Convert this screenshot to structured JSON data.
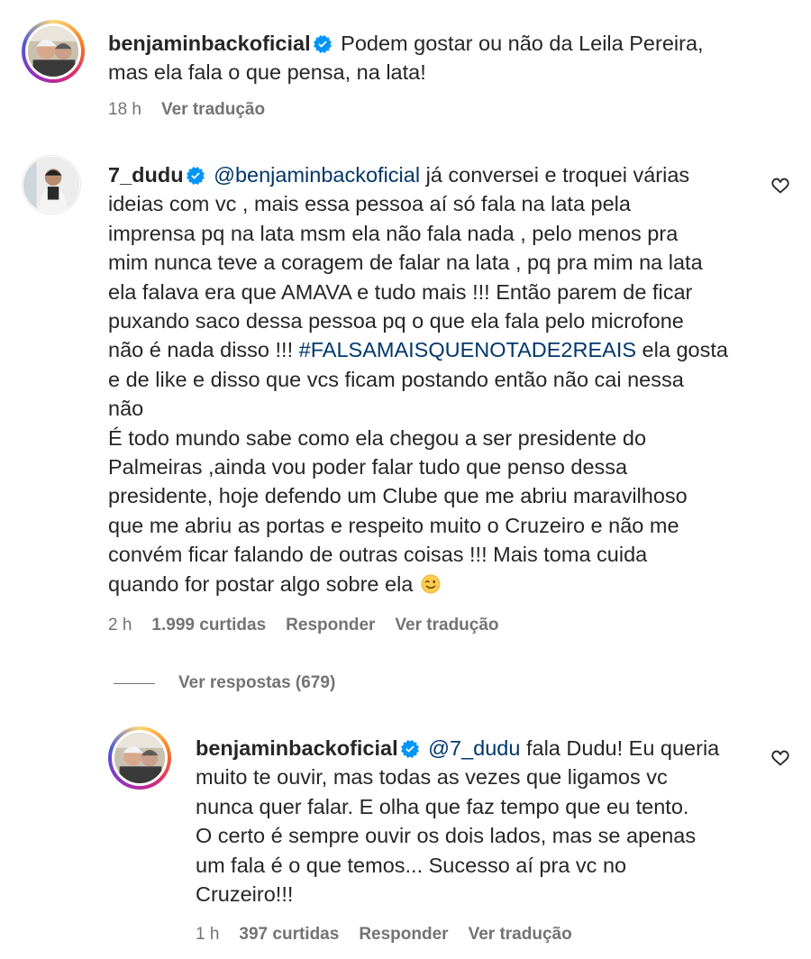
{
  "comments": [
    {
      "username": "benjaminbackoficial",
      "body_lines": [
        "Podem gostar ou não da Leila Pereira,",
        "mas ela fala o que pensa, na lata!"
      ],
      "time": "18 h",
      "translate": "Ver tradução"
    },
    {
      "username": "7_dudu",
      "mention": "@benjaminbackoficial",
      "body_lines": [
        " já conversei e troquei várias",
        "ideias com vc , mais essa pessoa aí só fala na lata pela",
        "imprensa pq na lata msm ela não fala nada , pelo menos pra",
        "mim nunca teve a coragem de falar na lata , pq pra mim na lata",
        "ela falava era que AMAVA e tudo mais !!! Então parem de ficar",
        "puxando saco dessa pessoa pq o que ela fala pelo microfone",
        "não é nada disso !!! "
      ],
      "hashtag": "#FALSAMAISQUENOTADE2REAIS",
      "body_after": [
        " ela gosta",
        "e de like e disso que vcs ficam postando então não cai nessa",
        "não",
        "É todo mundo sabe como ela chegou a ser presidente do",
        "Palmeiras ,ainda vou poder falar tudo que penso dessa",
        "presidente, hoje defendo um Clube que me abriu maravilhoso",
        "que me abriu as portas e respeito muito o Cruzeiro e não me",
        "convém ficar falando de outras coisas !!! Mais toma cuida",
        "quando for postar algo sobre ela"
      ],
      "emoji": "winking-face",
      "time": "2 h",
      "likes": "1.999 curtidas",
      "reply": "Responder",
      "translate": "Ver tradução",
      "view_replies": "Ver respostas (679)"
    },
    {
      "username": "benjaminbackoficial",
      "mention": "@7_dudu",
      "body_lines": [
        " fala Dudu! Eu queria",
        "muito te ouvir, mas todas as vezes que ligamos vc",
        "nunca quer falar. E olha que faz tempo que eu tento.",
        "O certo é sempre ouvir os dois lados, mas se apenas",
        "um fala é o que temos... Sucesso aí pra vc no",
        "Cruzeiro!!!"
      ],
      "time": "1 h",
      "likes": "397 curtidas",
      "reply": "Responder",
      "translate": "Ver tradução"
    }
  ],
  "colors": {
    "text": "#262626",
    "secondary": "#737373",
    "link": "#00376b",
    "verified": "#0095f6"
  },
  "icons": [
    "verified-badge-icon",
    "heart-outline-icon",
    "winking-face-emoji"
  ]
}
